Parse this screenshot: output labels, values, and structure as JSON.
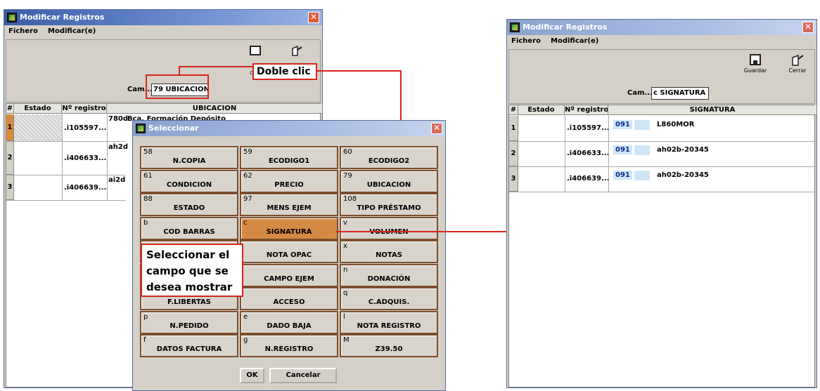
{
  "window1": {
    "title": "Modificar Registros",
    "menu": [
      "Fichero",
      "Modificar(e)"
    ],
    "campo_label": "Cam...",
    "campo_value": "79 UBICACION",
    "columns": [
      "#",
      "Estado",
      "Nº registro",
      "UBICACION"
    ],
    "rows": [
      {
        "num": "1",
        "registro": ".i105597...",
        "codigo": "780d",
        "valor": "Bca. Formación Depósito"
      },
      {
        "num": "2",
        "registro": ".i406633...",
        "codigo": "ah2d",
        "valor": ""
      },
      {
        "num": "3",
        "registro": ".i406639...",
        "codigo": "ai2d",
        "valor": ""
      }
    ]
  },
  "callout_doble_clic": "Doble clic",
  "dialog": {
    "title": "Seleccionar",
    "fields": [
      {
        "code": "58",
        "label": "N.COPIA"
      },
      {
        "code": "59",
        "label": "ECODIGO1"
      },
      {
        "code": "60",
        "label": "ECODIGO2"
      },
      {
        "code": "61",
        "label": "CONDICION"
      },
      {
        "code": "62",
        "label": "PRECIO"
      },
      {
        "code": "79",
        "label": "UBICACION"
      },
      {
        "code": "88",
        "label": "ESTADO"
      },
      {
        "code": "97",
        "label": "MENS EJEM"
      },
      {
        "code": "108",
        "label": "TIPO PRÉSTAMO"
      },
      {
        "code": "b",
        "label": "COD BARRAS"
      },
      {
        "code": "c",
        "label": "SIGNATURA",
        "selected": true
      },
      {
        "code": "v",
        "label": "VOLUMEN"
      },
      {
        "code": "",
        "label": ""
      },
      {
        "code": "",
        "label": "NOTA OPAC"
      },
      {
        "code": "x",
        "label": "NOTAS"
      },
      {
        "code": "",
        "label": ""
      },
      {
        "code": "",
        "label": "CAMPO EJEM"
      },
      {
        "code": "n",
        "label": "DONACIÓN"
      },
      {
        "code": "",
        "label": "F.LIBERTAS"
      },
      {
        "code": "",
        "label": "ACCESO"
      },
      {
        "code": "q",
        "label": "C.ADQUIS."
      },
      {
        "code": "p",
        "label": "N.PEDIDO"
      },
      {
        "code": "e",
        "label": "DADO BAJA"
      },
      {
        "code": "l",
        "label": "NOTA REGISTRO"
      },
      {
        "code": "f",
        "label": "DATOS FACTURA"
      },
      {
        "code": "g",
        "label": "N.REGISTRO"
      },
      {
        "code": "M",
        "label": "Z39.50"
      }
    ],
    "ok_label": "OK",
    "cancel_label": "Cancelar"
  },
  "callout_seleccionar": "Seleccionar el campo que se desea mostrar",
  "window2": {
    "title": "Modificar Registros",
    "menu": [
      "Fichero",
      "Modificar(e)"
    ],
    "guardar_label": "Guardar",
    "cerrar_label": "Cerrar",
    "campo_label": "Cam...",
    "campo_value": "c SIGNATURA",
    "columns": [
      "#",
      "Estado",
      "Nº registro",
      "SIGNATURA"
    ],
    "rows": [
      {
        "num": "1",
        "registro": ".i105597...",
        "tag": "091",
        "valor": "L860MOR"
      },
      {
        "num": "2",
        "registro": ".i406633...",
        "tag": "091",
        "valor": "ah02b-20345"
      },
      {
        "num": "3",
        "registro": ".i406639...",
        "tag": "091",
        "valor": "ah02b-20345"
      }
    ]
  },
  "colors": {
    "callout_red": "#d9251d",
    "selected_field": "#d58a44",
    "title_blue": "#3a5fa8"
  }
}
